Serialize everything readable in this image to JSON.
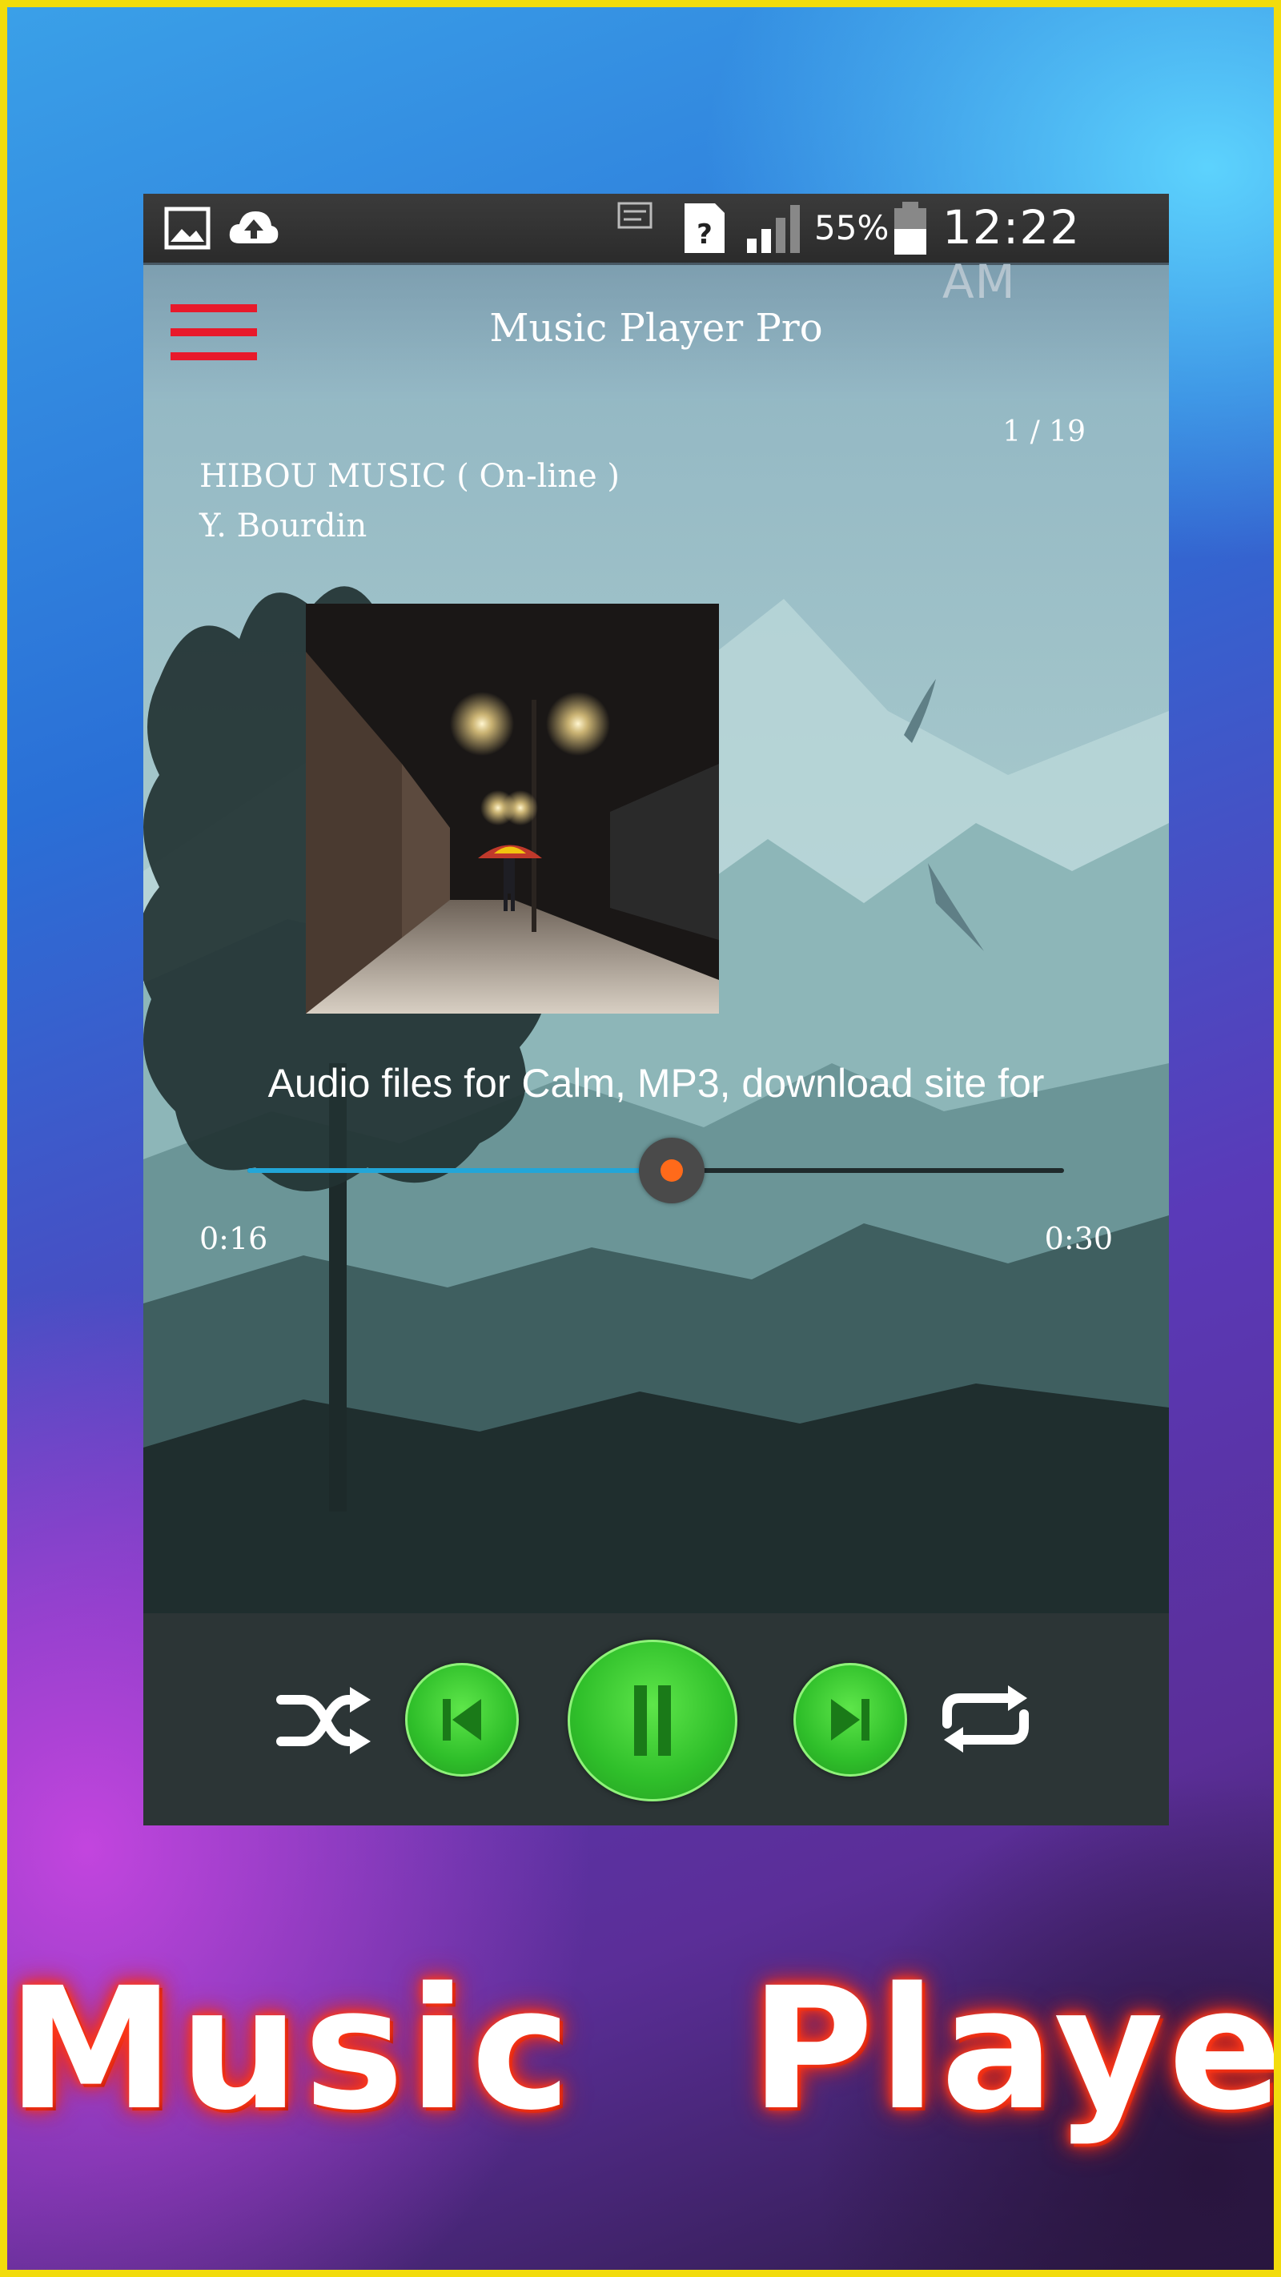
{
  "status_bar": {
    "battery": "55%",
    "time": "12:22 AM",
    "icons": [
      "image-icon",
      "cloud-upload-icon",
      "notification-icon",
      "sim-unknown-icon",
      "signal-icon",
      "battery-icon"
    ]
  },
  "header": {
    "title": "Music Player Pro",
    "menu_icon": "hamburger-menu-icon",
    "menu_color": "#e8192b"
  },
  "now_playing": {
    "count": "1 / 19",
    "title": "HIBOU MUSIC ( On-line )",
    "artist": "Y. Bourdin",
    "description": "Audio files for Calm, MP3, download site for",
    "current_time": "0:16",
    "total_time": "0:30",
    "progress": 0.52,
    "seek_color": "#22a6d8",
    "thumb_color": "#ff6a1a"
  },
  "controls": {
    "buttons": [
      "shuffle-icon",
      "previous-icon",
      "pause-icon",
      "next-icon",
      "repeat-icon"
    ],
    "accent": "#2fbf2a"
  },
  "promo": {
    "title": "Music  Player",
    "border_color": "#f2dc0c"
  }
}
